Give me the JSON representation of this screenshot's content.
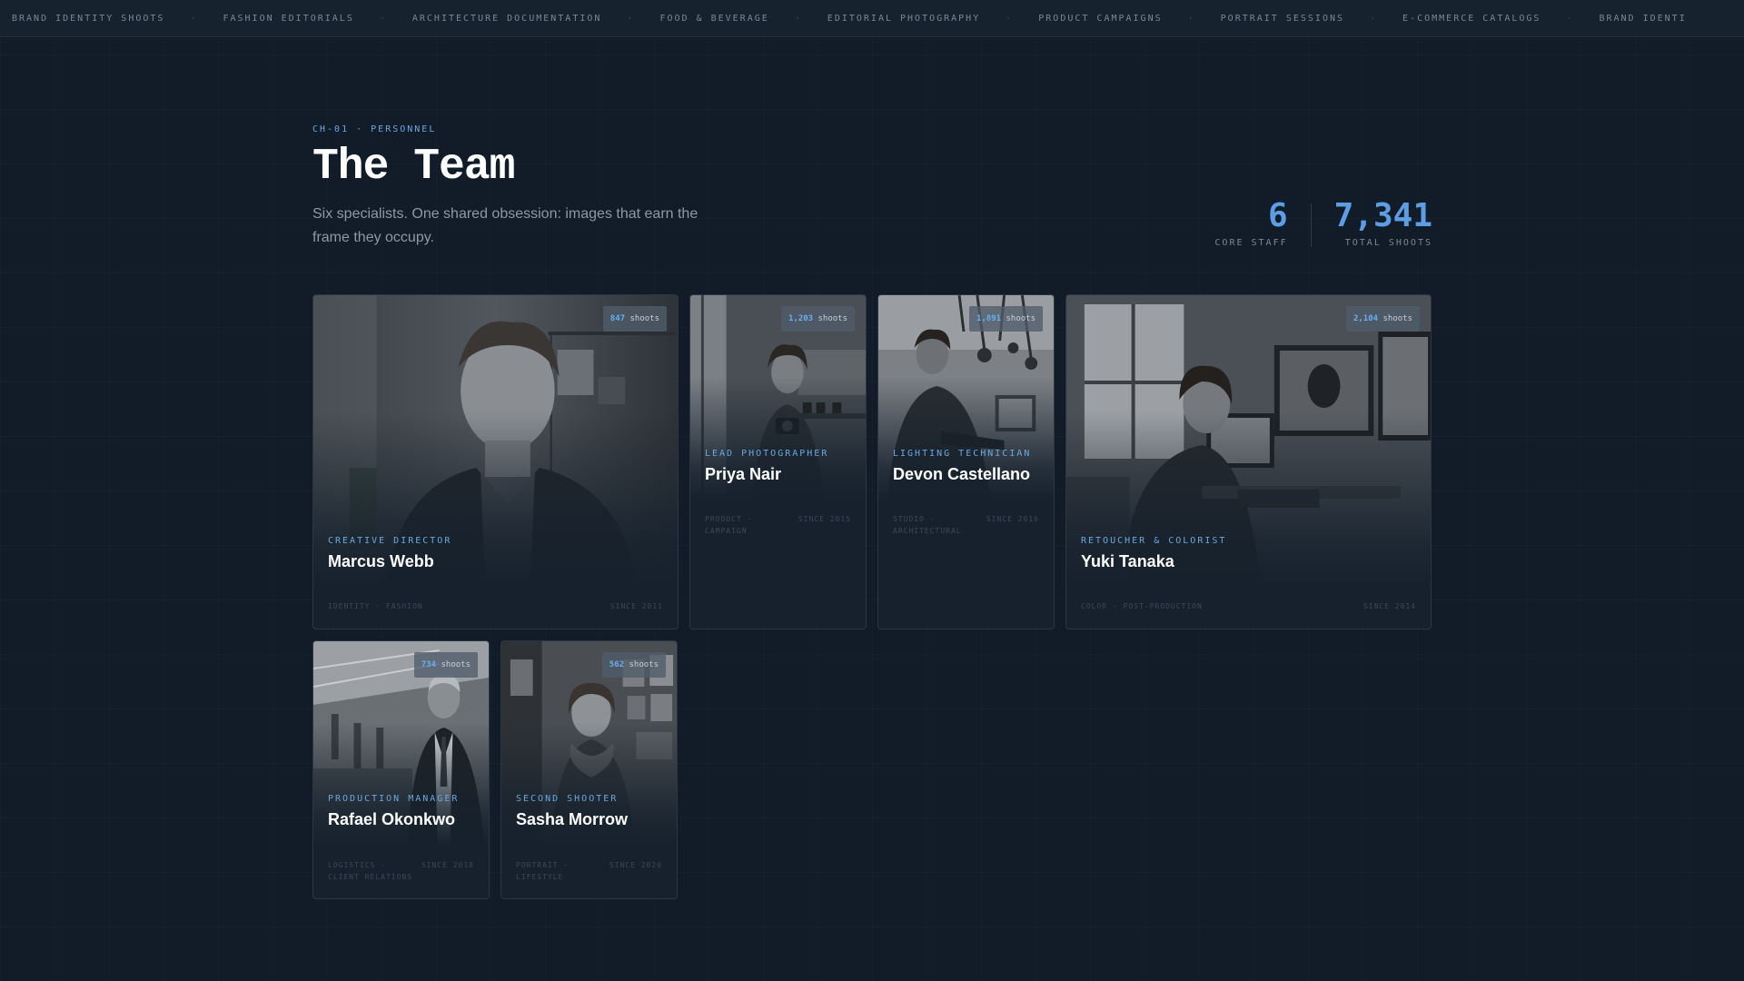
{
  "ticker": [
    "BRAND IDENTITY SHOOTS",
    "FASHION EDITORIALS",
    "ARCHITECTURE DOCUMENTATION",
    "FOOD & BEVERAGE",
    "EDITORIAL PHOTOGRAPHY",
    "PRODUCT CAMPAIGNS",
    "PORTRAIT SESSIONS",
    "E-COMMERCE CATALOGS",
    "BRAND IDENTI"
  ],
  "ticker_separator": "·",
  "section": {
    "eyebrow": "CH-01 · PERSONNEL",
    "title": "The Team",
    "subtitle": "Six specialists. One shared obsession: images that earn the frame they occupy."
  },
  "stats": [
    {
      "value": "6",
      "label": "CORE STAFF"
    },
    {
      "value": "7,341",
      "label": "TOTAL SHOOTS"
    }
  ],
  "badge_unit": "shoots",
  "members": [
    {
      "role": "CREATIVE DIRECTOR",
      "name": "Marcus Webb",
      "shoots": "847",
      "meta_left": "IDENTITY · FASHION",
      "meta_right": "SINCE 2011"
    },
    {
      "role": "LEAD PHOTOGRAPHER",
      "name": "Priya Nair",
      "shoots": "1,203",
      "meta_left": "PRODUCT · CAMPAIGN",
      "meta_right": "SINCE 2015"
    },
    {
      "role": "LIGHTING TECHNICIAN",
      "name": "Devon Castellano",
      "shoots": "1,891",
      "meta_left": "STUDIO · ARCHITECTURAL",
      "meta_right": "SINCE 2016"
    },
    {
      "role": "RETOUCHER & COLORIST",
      "name": "Yuki Tanaka",
      "shoots": "2,104",
      "meta_left": "COLOR · POST-PRODUCTION",
      "meta_right": "SINCE 2014"
    },
    {
      "role": "PRODUCTION MANAGER",
      "name": "Rafael Okonkwo",
      "shoots": "734",
      "meta_left": "LOGISTICS · CLIENT RELATIONS",
      "meta_right": "SINCE 2018"
    },
    {
      "role": "SECOND SHOOTER",
      "name": "Sasha Morrow",
      "shoots": "562",
      "meta_left": "PORTRAIT · LIFESTYLE",
      "meta_right": "SINCE 2020"
    }
  ]
}
